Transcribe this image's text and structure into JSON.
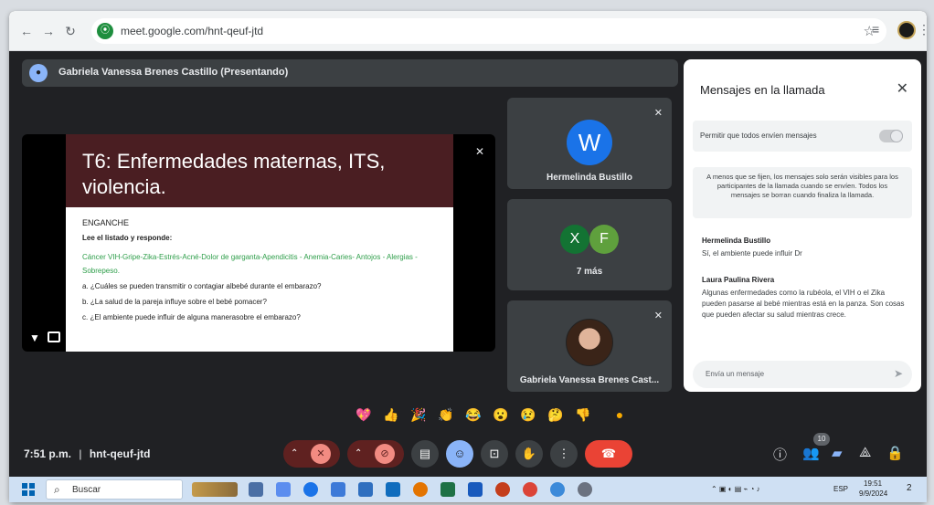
{
  "browser": {
    "url": "meet.google.com/hnt-qeuf-jtd",
    "back_icon": "arrow-left-icon",
    "forward_icon": "arrow-right-icon",
    "reload_icon": "reload-icon"
  },
  "presenter": {
    "banner": "Gabriela Vanessa Brenes Castillo (Presentando)"
  },
  "slide": {
    "title": "T6: Enfermedades maternas, ITS, violencia.",
    "section": "ENGANCHE",
    "instruction": "Lee el listado y responde:",
    "green_list": "Cáncer VIH-Gripe-Zika-Estrés-Acné-Dolor de garganta-Apendicitis - Anemia-Caries- Antojos - Alergias - Sobrepeso.",
    "question_a": "a. ¿Cuáles se pueden transmitir o contagiar albebé durante el embarazo?",
    "question_b": "b. ¿La salud de la pareja influye sobre el bebé pomacer?",
    "question_c": "c. ¿El ambiente puede influir de alguna manerasobre el embarazo?",
    "presenter_label": "Gabriela Vanessa Brenes Castillo"
  },
  "tiles": [
    {
      "initial": "W",
      "name": "Hermelinda Bustillo"
    },
    {
      "initials": [
        "X",
        "F"
      ],
      "name": "7 más"
    },
    {
      "name": "Gabriela Vanessa Brenes Cast..."
    }
  ],
  "chat": {
    "title": "Mensajes en la llamada",
    "allow_label": "Permitir que todos envíen mensajes",
    "info": "A menos que se fijen, los mensajes solo serán visibles para los participantes de la llamada cuando se envíen. Todos los mensajes se borran cuando finaliza la llamada.",
    "messages": [
      {
        "sender": "Hermelinda Bustillo",
        "text": "Sí, el ambiente puede influir Dr"
      },
      {
        "sender": "Laura Paulina Rivera",
        "text": "Algunas enfermedades como la rubéola, el VIH o el Zika pueden pasarse al bebé mientras está en la panza. Son cosas que pueden afectar su salud mientras crece."
      }
    ],
    "input_placeholder": "Envía un mensaje"
  },
  "reactions": [
    "💖",
    "👍",
    "🎉",
    "👏",
    "😂",
    "😮",
    "😢",
    "🤔",
    "👎",
    "●"
  ],
  "controls": {
    "time": "7:51 p.m.",
    "separator": "|",
    "meeting_code": "hnt-qeuf-jtd",
    "participant_count": "10"
  },
  "taskbar": {
    "search_label": "Buscar",
    "language": "ESP",
    "time": "19:51",
    "date": "9/9/2024",
    "notification_count": "2"
  },
  "colors": {
    "meet_background": "#202124",
    "slide_header": "#4a1e22",
    "accent_blue": "#1a73e8",
    "end_call": "#ea4335"
  }
}
